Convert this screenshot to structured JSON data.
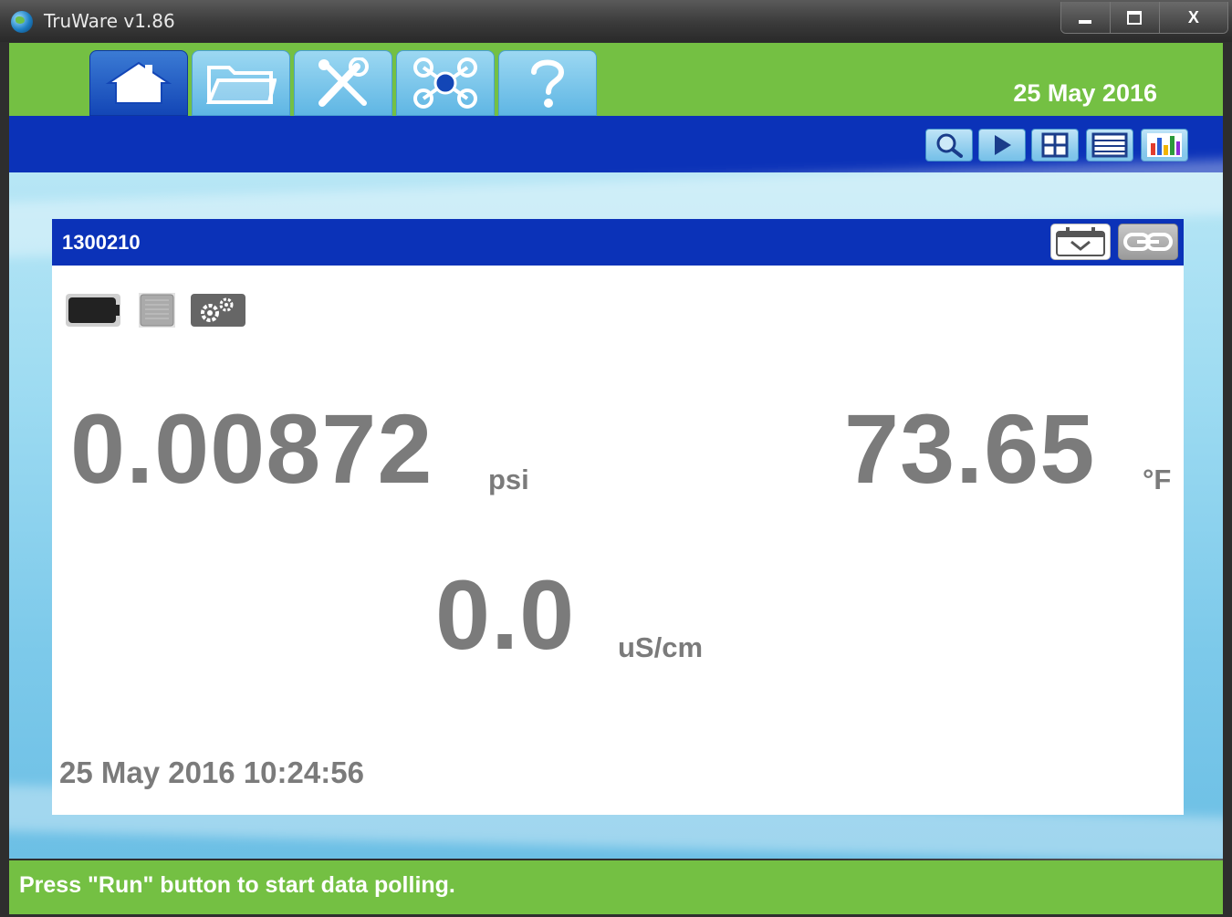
{
  "window": {
    "title": "TruWare v1.86",
    "controls": [
      "minimize",
      "maximize",
      "close"
    ],
    "close_glyph": "X"
  },
  "nav": {
    "tabs": [
      {
        "icon": "home-icon",
        "active": true
      },
      {
        "icon": "folder-icon",
        "active": false
      },
      {
        "icon": "tools-icon",
        "active": false
      },
      {
        "icon": "network-icon",
        "active": false
      },
      {
        "icon": "help-icon",
        "active": false
      }
    ],
    "date": "25 May 2016"
  },
  "toolbar": {
    "buttons": [
      "search-icon",
      "play-icon",
      "grid-view-icon",
      "list-view-icon",
      "bar-chart-icon"
    ]
  },
  "device": {
    "serial": "1300210",
    "header_buttons": [
      "calendar-dropdown-icon",
      "link-icon"
    ],
    "status_icons": [
      "battery-icon",
      "memory-icon",
      "gears-icon"
    ],
    "pressure": {
      "value": "0.00872",
      "unit": "psi"
    },
    "temperature": {
      "value": "73.65",
      "unit": "°F"
    },
    "conductivity": {
      "value": "0.0",
      "unit": "uS/cm"
    },
    "timestamp": "25 May 2016 10:24:56"
  },
  "status_bar": {
    "message": "Press \"Run\" button to start data polling."
  },
  "colors": {
    "green": "#74c043",
    "blue": "#0b32b8",
    "reading_gray": "#7b7b7b"
  }
}
